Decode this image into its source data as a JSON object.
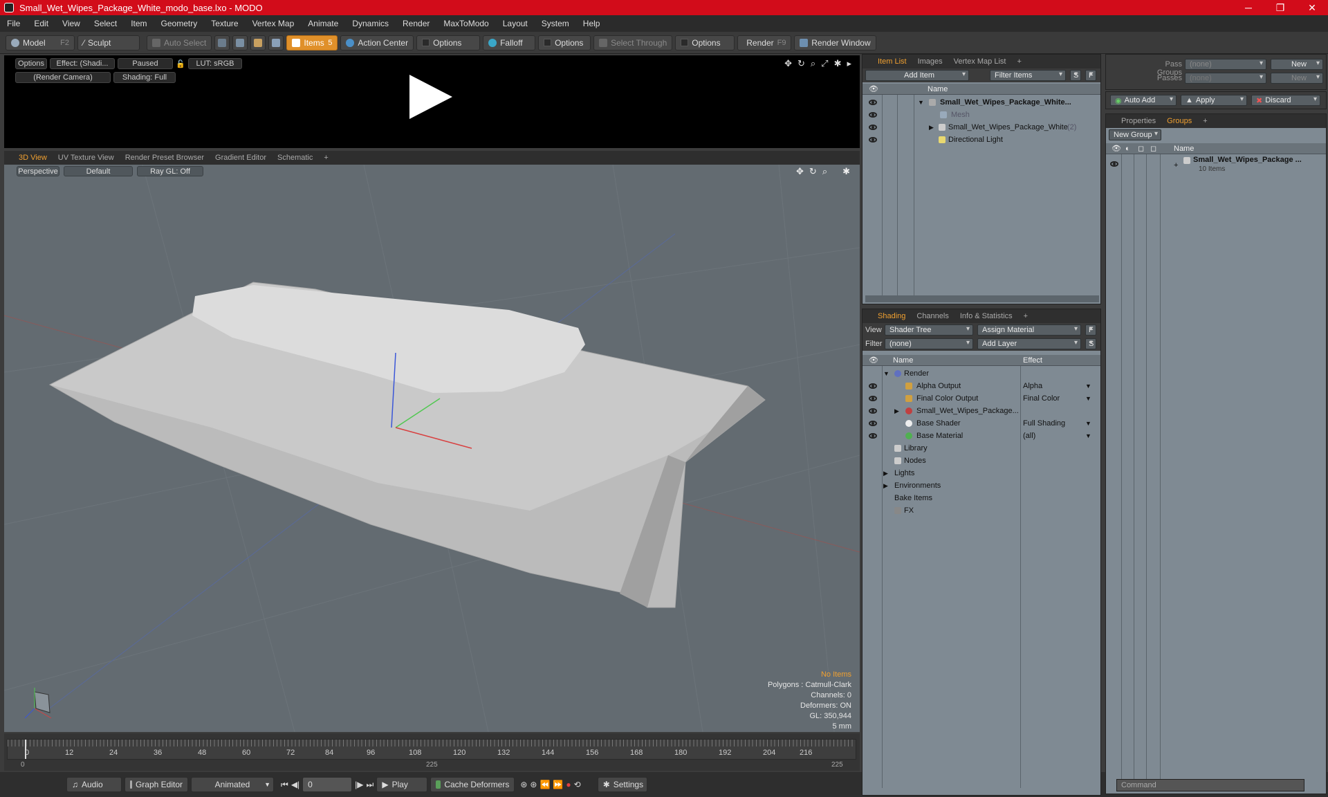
{
  "window": {
    "title": "Small_Wet_Wipes_Package_White_modo_base.lxo - MODO"
  },
  "menu": [
    "File",
    "Edit",
    "View",
    "Select",
    "Item",
    "Geometry",
    "Texture",
    "Vertex Map",
    "Animate",
    "Dynamics",
    "Render",
    "MaxToModo",
    "Layout",
    "System",
    "Help"
  ],
  "toolbar": {
    "model": "Model",
    "model_key": "F2",
    "sculpt": "Sculpt",
    "auto_select": "Auto Select",
    "items": "Items",
    "items_key": "5",
    "action_center": "Action Center",
    "options1": "Options",
    "falloff": "Falloff",
    "options2": "Options",
    "select_through": "Select Through",
    "options3": "Options",
    "render": "Render",
    "render_key": "F9",
    "render_window": "Render Window"
  },
  "preview": {
    "options": "Options",
    "effect": "Effect: (Shadi...",
    "paused": "Paused",
    "lut": "LUT: sRGB",
    "camera": "(Render Camera)",
    "shading": "Shading: Full"
  },
  "viewtabs": [
    "3D View",
    "UV Texture View",
    "Render Preset Browser",
    "Gradient Editor",
    "Schematic",
    "+"
  ],
  "viewport": {
    "perspective": "Perspective",
    "default": "Default",
    "raygl": "Ray GL: Off",
    "info_items": "No Items",
    "info": [
      "Polygons : Catmull-Clark",
      "Channels: 0",
      "Deformers: ON",
      "GL: 350,944",
      "5 mm"
    ]
  },
  "timeline": {
    "ticks": [
      "0",
      "12",
      "24",
      "36",
      "48",
      "60",
      "72",
      "84",
      "96",
      "108",
      "120",
      "132",
      "144",
      "156",
      "168",
      "180",
      "192",
      "204",
      "216"
    ],
    "bottom_left": "0",
    "bottom_mid": "225",
    "bottom_right": "225"
  },
  "bottombar": {
    "audio": "Audio",
    "graph": "Graph Editor",
    "animated": "Animated",
    "frame": "0",
    "play": "Play",
    "cache": "Cache Deformers",
    "settings": "Settings"
  },
  "itemlist": {
    "tabs": [
      "Item List",
      "Images",
      "Vertex Map List",
      "+"
    ],
    "add_item": "Add Item",
    "filter": "Filter Items",
    "s": "S",
    "f": "F",
    "col_name": "Name",
    "rows": [
      {
        "label": "Small_Wet_Wipes_Package_White...",
        "bold": true
      },
      {
        "label": "Mesh",
        "dim": true
      },
      {
        "label": "Small_Wet_Wipes_Package_White",
        "count": "(2)"
      },
      {
        "label": "Directional Light"
      }
    ]
  },
  "shading": {
    "tabs": [
      "Shading",
      "Channels",
      "Info & Statistics",
      "+"
    ],
    "view_label": "View",
    "view_value": "Shader Tree",
    "assign": "Assign Material",
    "f": "F",
    "filter_label": "Filter",
    "filter_value": "(none)",
    "add_layer": "Add Layer",
    "s": "S",
    "col_name": "Name",
    "col_effect": "Effect",
    "rows": [
      {
        "name": "Render",
        "effect": ""
      },
      {
        "name": "Alpha Output",
        "effect": "Alpha"
      },
      {
        "name": "Final Color Output",
        "effect": "Final Color"
      },
      {
        "name": "Small_Wet_Wipes_Package...",
        "effect": ""
      },
      {
        "name": "Base Shader",
        "effect": "Full Shading"
      },
      {
        "name": "Base Material",
        "effect": "(all)"
      },
      {
        "name": "Library",
        "effect": ""
      },
      {
        "name": "Nodes",
        "effect": ""
      },
      {
        "name": "Lights",
        "effect": ""
      },
      {
        "name": "Environments",
        "effect": ""
      },
      {
        "name": "Bake Items",
        "effect": ""
      },
      {
        "name": "FX",
        "effect": ""
      }
    ]
  },
  "passgroups": {
    "label": "Pass Groups",
    "value": "(none)",
    "new1": "New",
    "passes_label": "Passes",
    "passes_value": "(none)",
    "new2": "New"
  },
  "groups": {
    "auto_add": "Auto Add",
    "apply": "Apply",
    "discard": "Discard",
    "tabs": [
      "Properties",
      "Groups",
      "+"
    ],
    "new_group": "New Group",
    "col_name": "Name",
    "row_name": "Small_Wet_Wipes_Package ...",
    "row_sub": "10 Items"
  },
  "command": {
    "placeholder": "Command"
  }
}
